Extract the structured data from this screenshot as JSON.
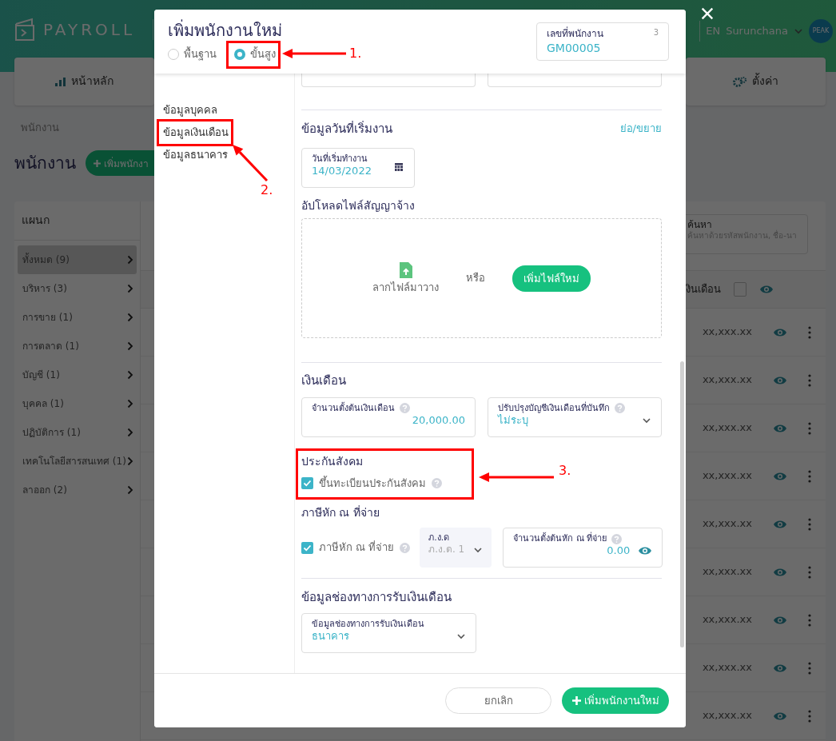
{
  "header": {
    "logo": "PAYROLL",
    "language": "EN",
    "user": "Surunchana",
    "avatar": "PEAK"
  },
  "nav_cards": [
    {
      "label": "หน้าหลัก",
      "kind": "chart"
    },
    {
      "label": "ตั้งค่า",
      "kind": "gear"
    }
  ],
  "breadcrumb": "พนักงาน",
  "page_title": "พนักงาน",
  "add_button": "เพิ่มพนักงา",
  "departments": {
    "title": "แผนก",
    "items": [
      {
        "label": "ทั้งหมด (9)",
        "selected": true
      },
      {
        "label": "บริหาร (3)",
        "selected": false
      },
      {
        "label": "การขาย (1)",
        "selected": false
      },
      {
        "label": "การตลาด (1)",
        "selected": false
      },
      {
        "label": "บัญชี (1)",
        "selected": false
      },
      {
        "label": "บุคคล (1)",
        "selected": false
      },
      {
        "label": "ปฏิบัติการ (1)",
        "selected": false
      },
      {
        "label": "เทคโนโลยีสารสนเทศ (1)",
        "selected": false
      },
      {
        "label": "ลาออก (2)",
        "selected": false
      }
    ]
  },
  "table": {
    "search_label": "ค้นหา",
    "search_placeholder": "ค้นหาด้วยรหัสพนักงาน, ชื่อ-นา",
    "salary_column": "งินเดือน",
    "rows": [
      {
        "salary": "xx,xxx.xx"
      },
      {
        "salary": "xx,xxx.xx"
      },
      {
        "salary": "xx,xxx.xx"
      },
      {
        "salary": "xx,xxx.xx"
      },
      {
        "salary": "xx,xxx.xx"
      },
      {
        "salary": "xx,xxx.xx"
      },
      {
        "salary": "xx,xxx.xx"
      },
      {
        "salary": "xx,xxx.xx"
      },
      {
        "salary": "xx,xxx.xx"
      }
    ]
  },
  "modal": {
    "title": "เพิ่มพนักงานใหม่",
    "modes": [
      {
        "label": "พื้นฐาน",
        "selected": false
      },
      {
        "label": "ขั้นสูง",
        "selected": true
      }
    ],
    "employee_number": {
      "label": "เลขที่พนักงาน",
      "counter": "3",
      "value": "GM00005"
    },
    "sections_nav": [
      {
        "label": "ข้อมูลบุคคล"
      },
      {
        "label": "ข้อมูลเงินเดือน"
      },
      {
        "label": "ข้อมูลธนาคาร"
      }
    ],
    "start_date": {
      "title": "ข้อมูลวันที่เริ่มงาน",
      "toggle": "ย่อ/ขยาย",
      "label": "วันที่เริ่มทำงาน",
      "value": "14/03/2022"
    },
    "upload": {
      "title": "อัปโหลดไฟล์สัญญาจ้าง",
      "drop_text": "ลากไฟล์มาวาง",
      "or": "หรือ",
      "button": "เพิ่มไฟล์ใหม่"
    },
    "salary": {
      "title": "เงินเดือน",
      "amount_label": "จำนวนตั้งต้นเงินเดือน",
      "amount": "20,000.00",
      "adjust_label": "ปรับปรุงบัญชีเงินเดือนที่บันทึก",
      "adjust_value": "ไม่ระบุ"
    },
    "social_security": {
      "title": "ประกันสังคม",
      "checkbox": "ขึ้นทะเบียนประกันสังคม",
      "checked": true
    },
    "withholding": {
      "title": "ภาษีหัก ณ ที่จ่าย",
      "checkbox": "ภาษีหัก ณ ที่จ่าย",
      "checked": true,
      "form_label": "ภ.ง.ด",
      "form_value": "ภ.ง.ด. 1",
      "amount_label": "จำนวนตั้งต้นหัก ณ ที่จ่าย",
      "amount": "0.00"
    },
    "payment": {
      "title": "ข้อมูลช่องทางการรับเงินเดือน",
      "label": "ข้อมูลช่องทางการรับเงินเดือน",
      "value": "ธนาคาร"
    },
    "cancel": "ยกเลิก",
    "submit": "เพิ่มพนักงานใหม่"
  },
  "annotations": [
    {
      "label": "1."
    },
    {
      "label": "2."
    },
    {
      "label": "3."
    }
  ]
}
